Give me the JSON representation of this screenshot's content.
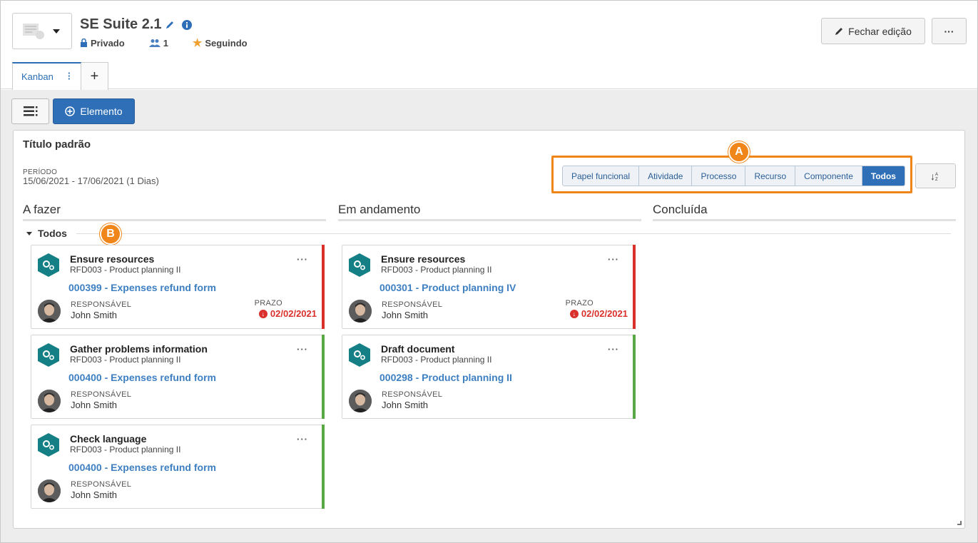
{
  "header": {
    "title": "SE Suite 2.1",
    "privacy": "Privado",
    "members_count": "1",
    "follow": "Seguindo",
    "close_edit": "Fechar edição",
    "more": "···"
  },
  "tabs": [
    {
      "label": "Kanban"
    },
    {
      "label": "+"
    }
  ],
  "toolbar": {
    "add_element": "Elemento"
  },
  "panel": {
    "title": "Título padrão",
    "period_label": "PERÍODO",
    "period_value": "15/06/2021 - 17/06/2021 (1 Dias)",
    "filters": [
      "Papel funcional",
      "Atividade",
      "Processo",
      "Recurso",
      "Componente",
      "Todos"
    ],
    "active_filter": "Todos",
    "sort_label": "↓",
    "markers": [
      "A",
      "B"
    ]
  },
  "columns": [
    "A fazer",
    "Em andamento",
    "Concluída"
  ],
  "group": "Todos",
  "labels": {
    "responsible": "RESPONSÁVEL",
    "due": "PRAZO"
  },
  "colors": {
    "accent": "#2e6fb7",
    "marker": "#f0861a",
    "overdue": "#d9302c",
    "ontime": "#5aa845",
    "hex": "#157f86"
  },
  "cards": [
    {
      "title": "Ensure resources",
      "sub": "RFD003 - Product planning II",
      "link": "000399 - Expenses refund form",
      "responsible": "John Smith",
      "due": "02/02/2021",
      "status": "overdue"
    },
    {
      "title": "Gather problems information",
      "sub": "RFD003 - Product planning II",
      "link": "000400 - Expenses refund form",
      "responsible": "John Smith",
      "due": "",
      "status": "ontime"
    },
    {
      "title": "Check language",
      "sub": "RFD003 - Product planning II",
      "link": "000400 - Expenses refund form",
      "responsible": "John Smith",
      "due": "",
      "status": "ontime"
    },
    {
      "title": "Ensure resources",
      "sub": "RFD003 - Product planning II",
      "link": "000301 - Product planning IV",
      "responsible": "John Smith",
      "due": "02/02/2021",
      "status": "overdue"
    },
    {
      "title": "Draft document",
      "sub": "RFD003 - Product planning II",
      "link": "000298 - Product planning II",
      "responsible": "John Smith",
      "due": "",
      "status": "ontime"
    }
  ]
}
